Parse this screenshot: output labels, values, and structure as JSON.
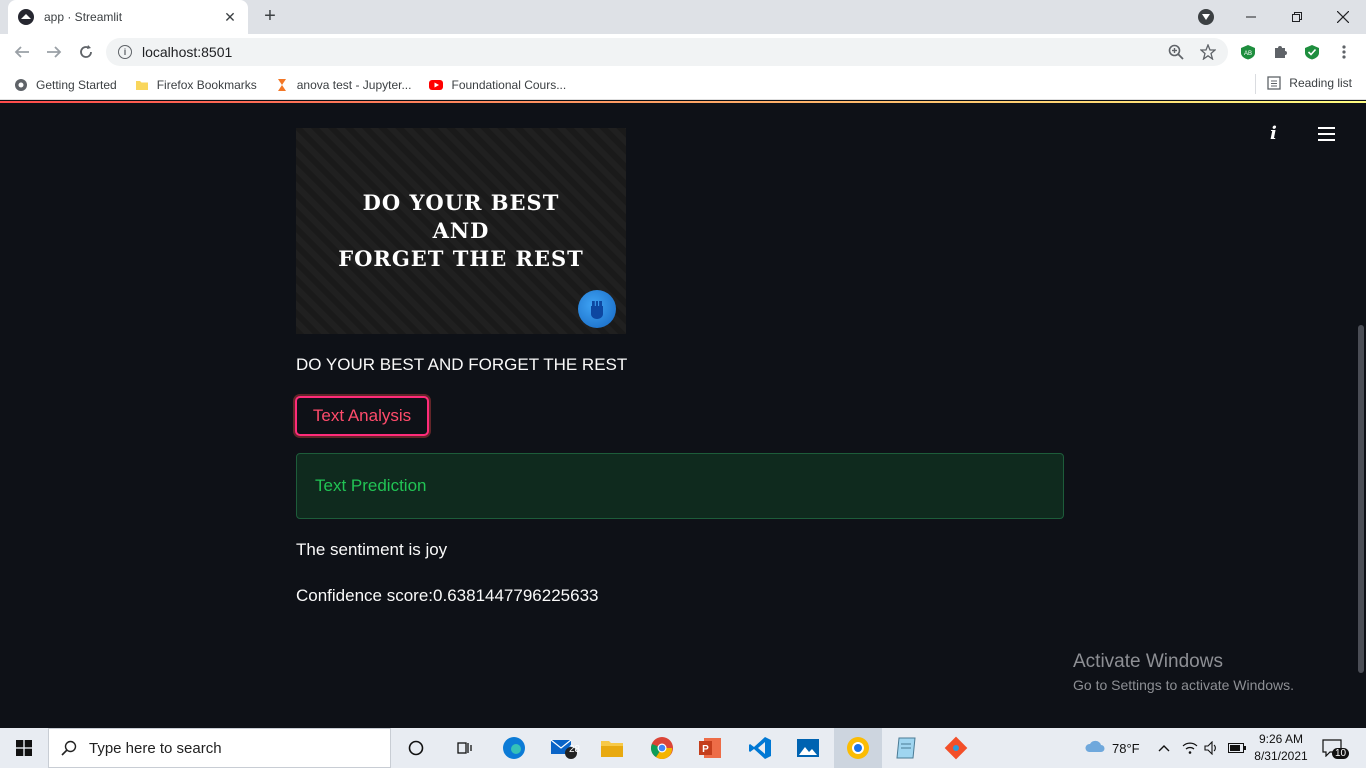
{
  "browser": {
    "tab_title": "app · Streamlit",
    "url": "localhost:8501",
    "bookmarks": [
      {
        "label": "Getting Started",
        "icon": "globe-icon"
      },
      {
        "label": "Firefox Bookmarks",
        "icon": "folder-icon"
      },
      {
        "label": "anova test - Jupyter...",
        "icon": "jupyter-icon"
      },
      {
        "label": "Foundational Cours...",
        "icon": "youtube-icon"
      }
    ],
    "reading_list": "Reading list",
    "profile_badge": "AB"
  },
  "app": {
    "banner_lines": [
      "DO YOUR BEST",
      "AND",
      "FORGET THE REST"
    ],
    "caption": "DO YOUR BEST AND FORGET THE REST",
    "button_label": "Text Analysis",
    "success_message": "Text Prediction",
    "sentiment_text": "The sentiment is joy",
    "confidence_text": "Confidence score:0.6381447796225633"
  },
  "watermark": {
    "title": "Activate Windows",
    "subtitle": "Go to Settings to activate Windows."
  },
  "taskbar": {
    "search_placeholder": "Type here to search",
    "mail_badge": "28",
    "weather": "78°F",
    "time": "9:26 AM",
    "date": "8/31/2021",
    "notification_count": "10"
  },
  "colors": {
    "app_bg": "#0e1117",
    "button_border": "#ff2b7a",
    "success_text": "#21c354",
    "success_bg": "#0f2a1e"
  }
}
